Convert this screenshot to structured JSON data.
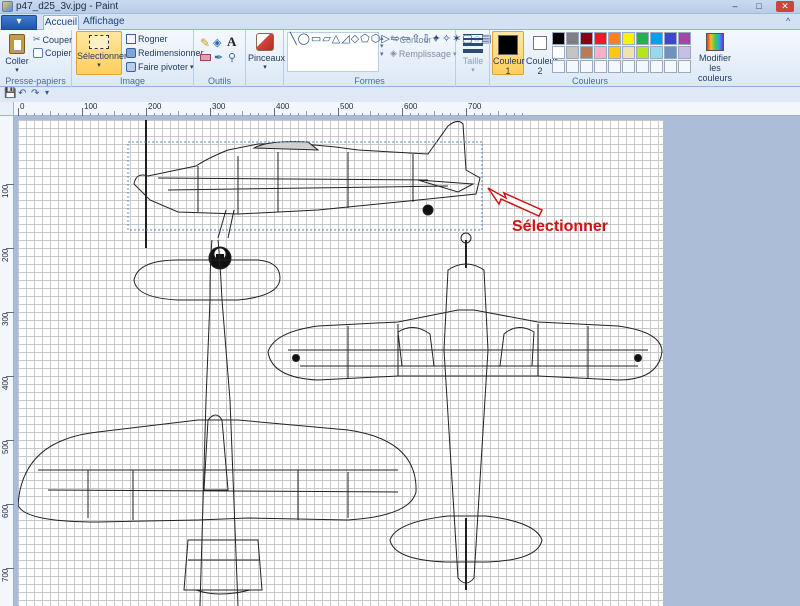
{
  "window": {
    "title": "p47_d25_3v.jpg - Paint"
  },
  "tabs": {
    "file": "▾",
    "home": "Accueil",
    "view": "Affichage"
  },
  "clipboard": {
    "paste": "Coller",
    "cut": "Couper",
    "copy": "Copier",
    "label": "Presse-papiers"
  },
  "image": {
    "select": "Sélectionner",
    "crop": "Rogner",
    "resize": "Redimensionner",
    "rotate": "Faire pivoter",
    "label": "Image"
  },
  "tools": {
    "label": "Outils"
  },
  "brushes": {
    "label": "Pinceaux"
  },
  "shapes": {
    "outline": "Contour",
    "fill": "Remplissage",
    "label": "Formes"
  },
  "size": {
    "label": "Taille"
  },
  "colors": {
    "color1_label": "Couleur",
    "color1_num": "1",
    "color2_label": "Couleur",
    "color2_num": "2",
    "label": "Couleurs",
    "edit": "Modifier les couleurs",
    "color1": "#000000",
    "color2": "#ffffff",
    "palette": [
      "#000000",
      "#7f7f7f",
      "#880015",
      "#ed1c24",
      "#ff7f27",
      "#fff200",
      "#22b14c",
      "#00a2e8",
      "#3f48cc",
      "#a349a4",
      "#ffffff",
      "#c3c3c3",
      "#b97a57",
      "#ffaec9",
      "#ffc90e",
      "#efe4b0",
      "#b5e61d",
      "#99d9ea",
      "#7092be",
      "#c8bfe7"
    ]
  },
  "ruler": {
    "h": [
      "0",
      "100",
      "200",
      "300",
      "400",
      "500",
      "600",
      "700"
    ],
    "v": [
      "100",
      "200",
      "300",
      "400",
      "500",
      "600",
      "700"
    ]
  },
  "annotation": {
    "text": "Sélectionner"
  }
}
